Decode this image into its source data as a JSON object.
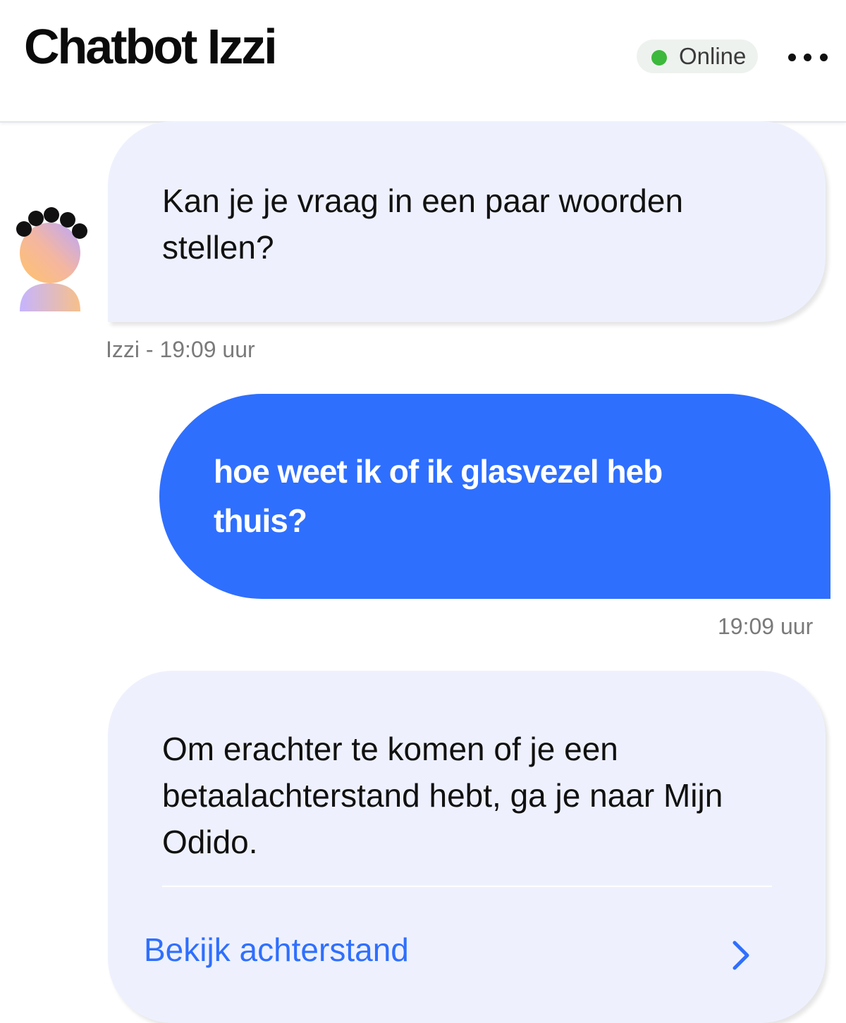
{
  "header": {
    "title": "Chatbot Izzi",
    "status": "Online",
    "status_color": "#3cb83c",
    "menu_icon": "more-horizontal-icon"
  },
  "messages": [
    {
      "sender": "bot",
      "text": "Kan je je vraag in een paar woorden stellen?",
      "meta": "Izzi - 19:09 uur"
    },
    {
      "sender": "user",
      "text": "hoe weet ik of ik glasvezel heb thuis?",
      "meta": "19:09 uur"
    },
    {
      "sender": "bot",
      "text": "Om erachter te komen of je een betaalachterstand hebt, ga je naar Mijn Odido.",
      "link_label": "Bekijk achterstand",
      "link_icon": "chevron-right-icon"
    }
  ],
  "colors": {
    "user_bubble": "#2f6ffe",
    "bot_bubble": "#eef1fd",
    "link": "#2f6ffe"
  }
}
